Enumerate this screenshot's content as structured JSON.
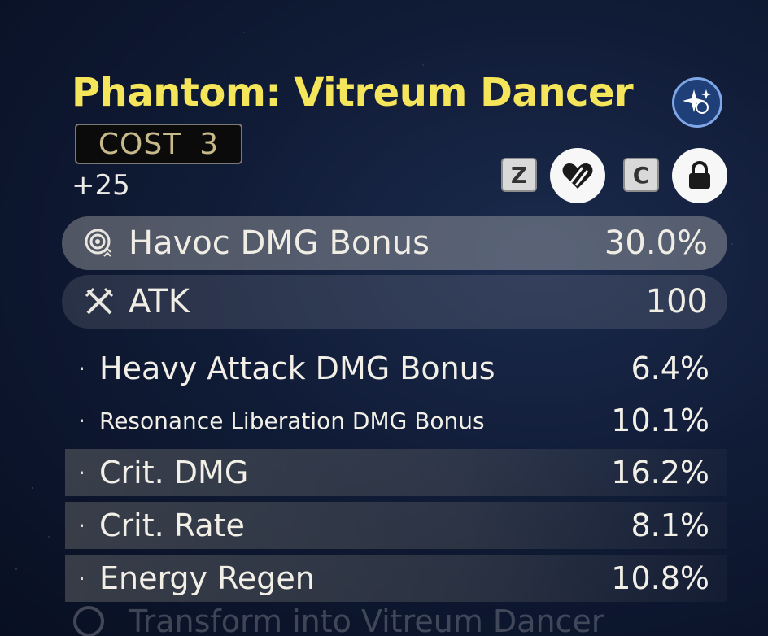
{
  "echo": {
    "title": "Phantom: Vitreum Dancer",
    "cost_label": "COST",
    "cost_value": "3",
    "level": "+25"
  },
  "actions": {
    "discard_key": "Z",
    "lock_key": "C"
  },
  "main_stats": [
    {
      "label": "Havoc DMG Bonus",
      "value": "30.0%",
      "icon": "havoc-icon"
    },
    {
      "label": "ATK",
      "value": "100",
      "icon": "atk-swords-icon"
    }
  ],
  "sub_stats": [
    {
      "label": "Heavy Attack DMG Bonus",
      "value": "6.4%"
    },
    {
      "label": "Resonance Liberation DMG Bonus",
      "value": "10.1%"
    },
    {
      "label": "Crit. DMG",
      "value": "16.2%"
    },
    {
      "label": "Crit. Rate",
      "value": "8.1%"
    },
    {
      "label": "Energy Regen",
      "value": "10.8%"
    }
  ],
  "footer": {
    "text": "Transform into Vitreum Dancer"
  },
  "colors": {
    "title": "#f4e55a",
    "cost_text": "#c8b98a",
    "background": "#0f1a34"
  }
}
